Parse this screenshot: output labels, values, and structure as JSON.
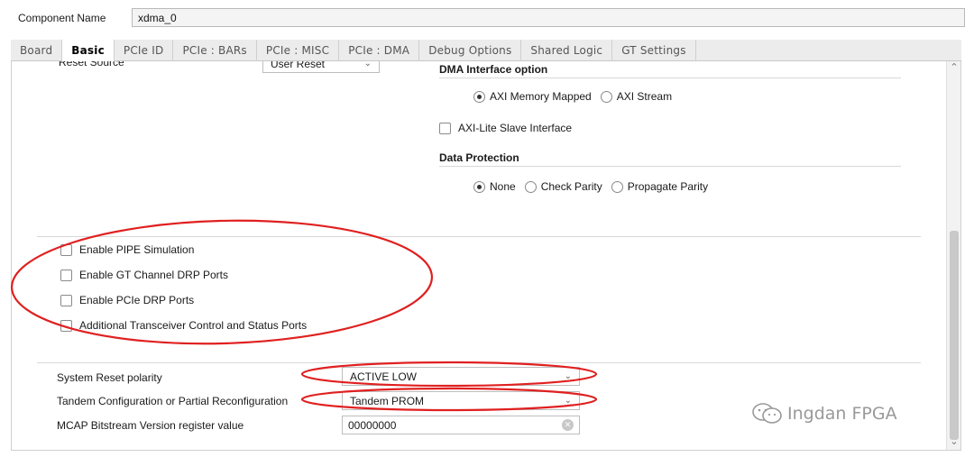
{
  "component": {
    "label": "Component Name",
    "value": "xdma_0"
  },
  "tabs": [
    {
      "label": "Board",
      "active": false
    },
    {
      "label": "Basic",
      "active": true
    },
    {
      "label": "PCIe ID",
      "active": false
    },
    {
      "label": "PCIe : BARs",
      "active": false
    },
    {
      "label": "PCIe : MISC",
      "active": false
    },
    {
      "label": "PCIe : DMA",
      "active": false
    },
    {
      "label": "Debug Options",
      "active": false
    },
    {
      "label": "Shared Logic",
      "active": false
    },
    {
      "label": "GT Settings",
      "active": false
    }
  ],
  "reset_source": {
    "label": "Reset Source",
    "value": "User Reset"
  },
  "dma_interface": {
    "title": "DMA Interface option",
    "options": [
      {
        "label": "AXI Memory Mapped",
        "selected": true
      },
      {
        "label": "AXI Stream",
        "selected": false
      }
    ],
    "axilite_label": "AXI-Lite Slave Interface"
  },
  "data_protection": {
    "title": "Data Protection",
    "options": [
      {
        "label": "None",
        "selected": true
      },
      {
        "label": "Check Parity",
        "selected": false
      },
      {
        "label": "Propagate Parity",
        "selected": false
      }
    ]
  },
  "checkboxes": [
    {
      "label": "Enable PIPE Simulation",
      "checked": false
    },
    {
      "label": "Enable GT Channel DRP Ports",
      "checked": false
    },
    {
      "label": "Enable PCIe DRP Ports",
      "checked": false
    },
    {
      "label": "Additional Transceiver Control and Status Ports",
      "checked": false
    }
  ],
  "settings": {
    "reset_polarity": {
      "label": "System Reset polarity",
      "value": "ACTIVE LOW"
    },
    "tandem": {
      "label": "Tandem Configuration or Partial Reconfiguration",
      "value": "Tandem PROM"
    },
    "mcap": {
      "label": "MCAP Bitstream Version register value",
      "value": "00000000"
    }
  },
  "watermark": {
    "text": "Ingdan FPGA"
  },
  "colors": {
    "annotation": "#e02020",
    "active_tab_bg": "#ffffff",
    "tab_bg": "#ececec"
  }
}
